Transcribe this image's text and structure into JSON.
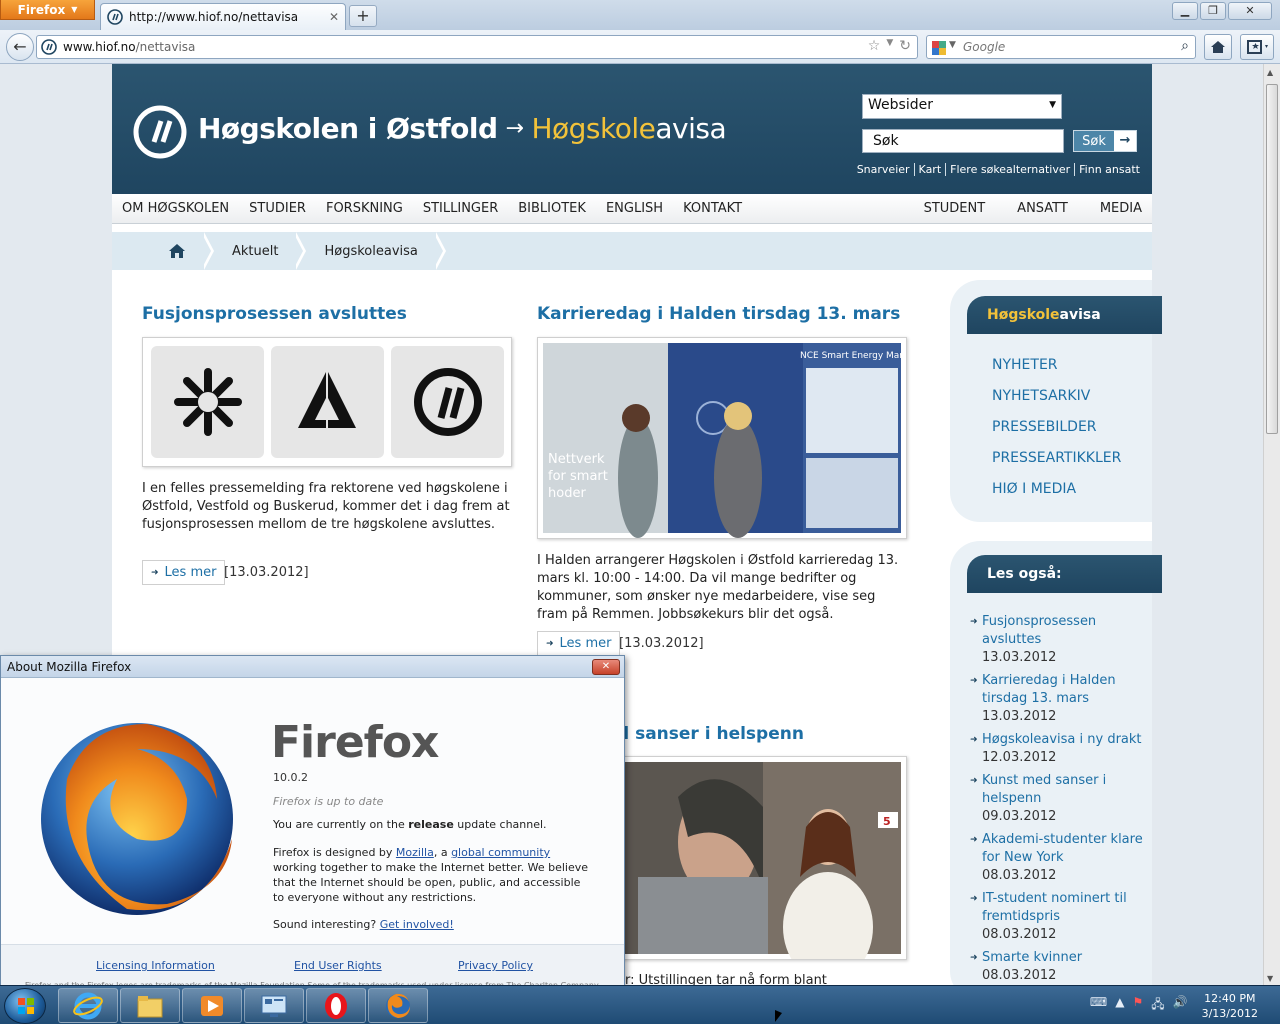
{
  "browser": {
    "menu_label": "Firefox",
    "tab_title": "http://www.hiof.no/nettavisa",
    "url_host": "www.hiof.no",
    "url_path": "/nettavisa",
    "search_placeholder": "Google"
  },
  "site": {
    "brand_main": "Høgskolen i Østfold",
    "brand_arrow": "→",
    "brand_hs": "Høgskole",
    "brand_av": "avisa",
    "websider_label": "Websider",
    "search_value": "Søk",
    "search_button": "Søk",
    "quicklinks": [
      "Snarveier",
      "Kart",
      "Flere søkealternativer",
      "Finn ansatt"
    ],
    "nav_left": [
      "OM HØGSKOLEN",
      "STUDIER",
      "FORSKNING",
      "STILLINGER",
      "BIBLIOTEK",
      "ENGLISH",
      "KONTAKT"
    ],
    "nav_right": [
      "STUDENT",
      "ANSATT",
      "MEDIA"
    ],
    "breadcrumb": [
      "Aktuelt",
      "Høgskoleavisa"
    ]
  },
  "articles": [
    {
      "title": "Fusjonsprosessen avsluttes",
      "text": "I en felles pressemelding fra rektorene ved høgskolene i Østfold, Vestfold og Buskerud, kommer det i dag frem at fusjonsprosessen mellom de tre høgskolene avsluttes.",
      "more": "Les mer",
      "date": "[13.03.2012]"
    },
    {
      "title": "Karrieredag i Halden tirsdag 13. mars",
      "text": "I Halden arrangerer Høgskolen i Østfold karrieredag 13. mars kl. 10:00 - 14:00. Da vil mange bedrifter og kommuner, som ønsker nye medarbeidere, vise seg fram på Remmen. Jobbsøkekurs blir det også.",
      "more": "Les mer",
      "date": "[13.03.2012]",
      "image_caption": "Nettverk for smart hoder",
      "booth_text": "NCE Smart Energy Markets"
    },
    {
      "title_partial": "d sanser i helspenn",
      "text_partial": "er: Utstillingen tar nå form blant",
      "badge": "5"
    }
  ],
  "sidebar": {
    "head_hs": "Høgskole",
    "head_av": "avisa",
    "links": [
      "NYHETER",
      "NYHETSARKIV",
      "PRESSEBILDER",
      "PRESSEARTIKKLER",
      "HIØ I MEDIA"
    ],
    "les_head": "Les også:",
    "les_items": [
      {
        "title": "Fusjonsprosessen avsluttes",
        "date": "13.03.2012"
      },
      {
        "title": "Karrieredag i Halden tirsdag 13. mars",
        "date": "13.03.2012"
      },
      {
        "title": "Høgskoleavisa i ny drakt",
        "date": "12.03.2012"
      },
      {
        "title": "Kunst med sanser i helspenn",
        "date": "09.03.2012"
      },
      {
        "title": "Akademi-studenter klare for New York",
        "date": "08.03.2012"
      },
      {
        "title": "IT-student nominert til fremtidspris",
        "date": "08.03.2012"
      },
      {
        "title": "Smarte kvinner",
        "date": "08.03.2012"
      }
    ]
  },
  "about": {
    "window_title": "About Mozilla Firefox",
    "close": "✕",
    "name": "Firefox",
    "version": "10.0.2",
    "status": "Firefox is up to date",
    "channel_pre": "You are currently on the ",
    "channel_bold": "release",
    "channel_post": " update channel.",
    "desc_1": "Firefox is designed by ",
    "desc_link1": "Mozilla",
    "desc_2": ", a ",
    "desc_link2": "global community",
    "desc_3": " working together to make the Internet better. We believe that the Internet should be open, public, and accessible to everyone without any restrictions.",
    "involved_pre": "Sound interesting? ",
    "involved_link": "Get involved!",
    "foot_links": [
      "Licensing Information",
      "End User Rights",
      "Privacy Policy"
    ],
    "trademark": "Firefox and the Firefox logos are trademarks of the Mozilla Foundation.Some of the trademarks used under license from The Charlton Company."
  },
  "taskbar": {
    "time": "12:40 PM",
    "date": "3/13/2012"
  }
}
